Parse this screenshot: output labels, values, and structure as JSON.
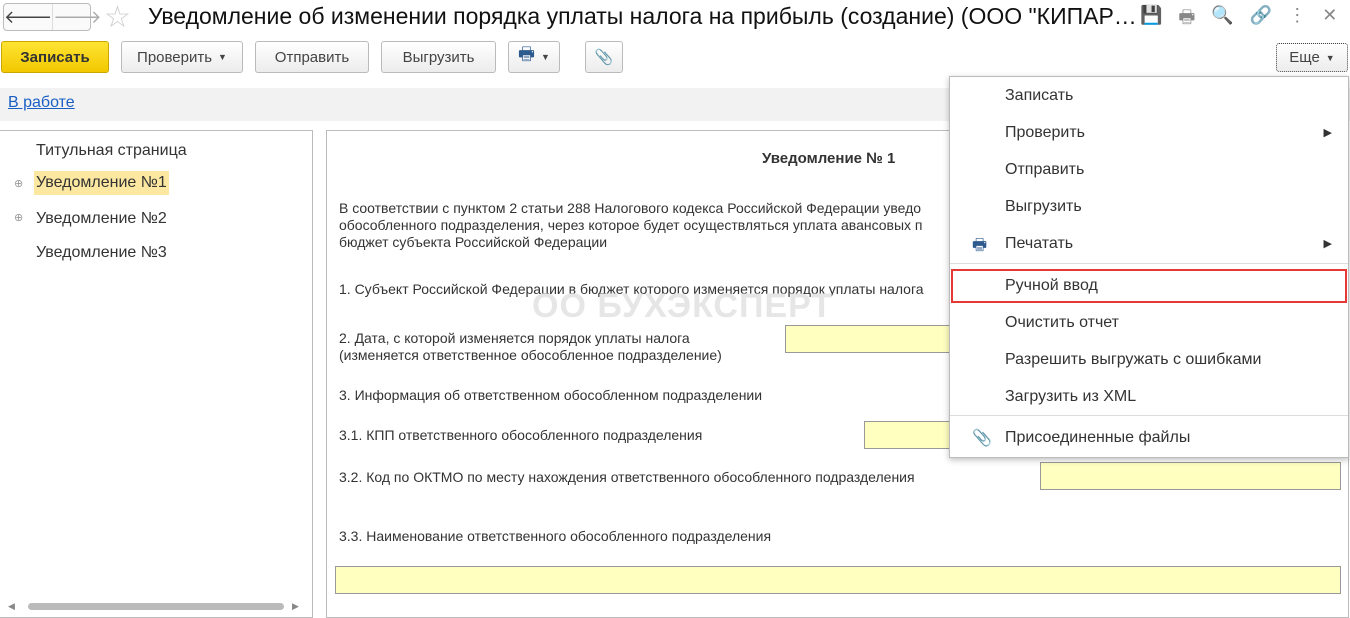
{
  "window": {
    "title": "Уведомление об изменении порядка уплаты налога на прибыль (создание) (ООО \"КИПАР…",
    "back": "🡐",
    "forward": "🡒",
    "star": "☆"
  },
  "title_icons": [
    "💾",
    "🖶",
    "🔍",
    "🔗",
    "⋮",
    "✕"
  ],
  "toolbar": {
    "save": "Записать",
    "check": "Проверить",
    "send": "Отправить",
    "export": "Выгрузить",
    "print": "🖶",
    "attach": "📎",
    "more": "Еще"
  },
  "status": {
    "link": "В работе"
  },
  "tree": {
    "items": [
      {
        "label": "Титульная страница"
      },
      {
        "label": "Уведомление №1"
      },
      {
        "label": "Уведомление №2"
      },
      {
        "label": "Уведомление №3"
      }
    ]
  },
  "doc": {
    "heading": "Уведомление № 1",
    "intro": [
      "В соответствии с пунктом 2 статьи 288 Налогового кодекса Российской Федерации уведо",
      "обособленного подразделения, через которое будет осуществляться уплата авансовых п",
      "бюджет субъекта Российской Федерации"
    ],
    "item1": "1. Субъект Российской Федерации в бюджет которого изменяется порядок уплаты налога",
    "item2a": "2. Дата, с которой изменяется порядок уплаты налога",
    "item2b": "(изменяется ответственное обособленное подразделение)",
    "item3": "3. Информация об ответственном обособленном подразделении",
    "item31": "3.1. КПП ответственного обособленного подразделения",
    "item32": "3.2. Код по ОКТМО по месту нахождения ответственного обособленного подразделения",
    "item33": "3.3. Наименование ответственного обособленного подразделения"
  },
  "watermark": "БУХЭКСПЕРТ",
  "menu": {
    "items": [
      "Записать",
      "Проверить",
      "Отправить",
      "Выгрузить",
      "Печатать",
      "Ручной ввод",
      "Очистить отчет",
      "Разрешить выгружать с ошибками",
      "Загрузить из XML",
      "Присоединенные файлы"
    ]
  }
}
